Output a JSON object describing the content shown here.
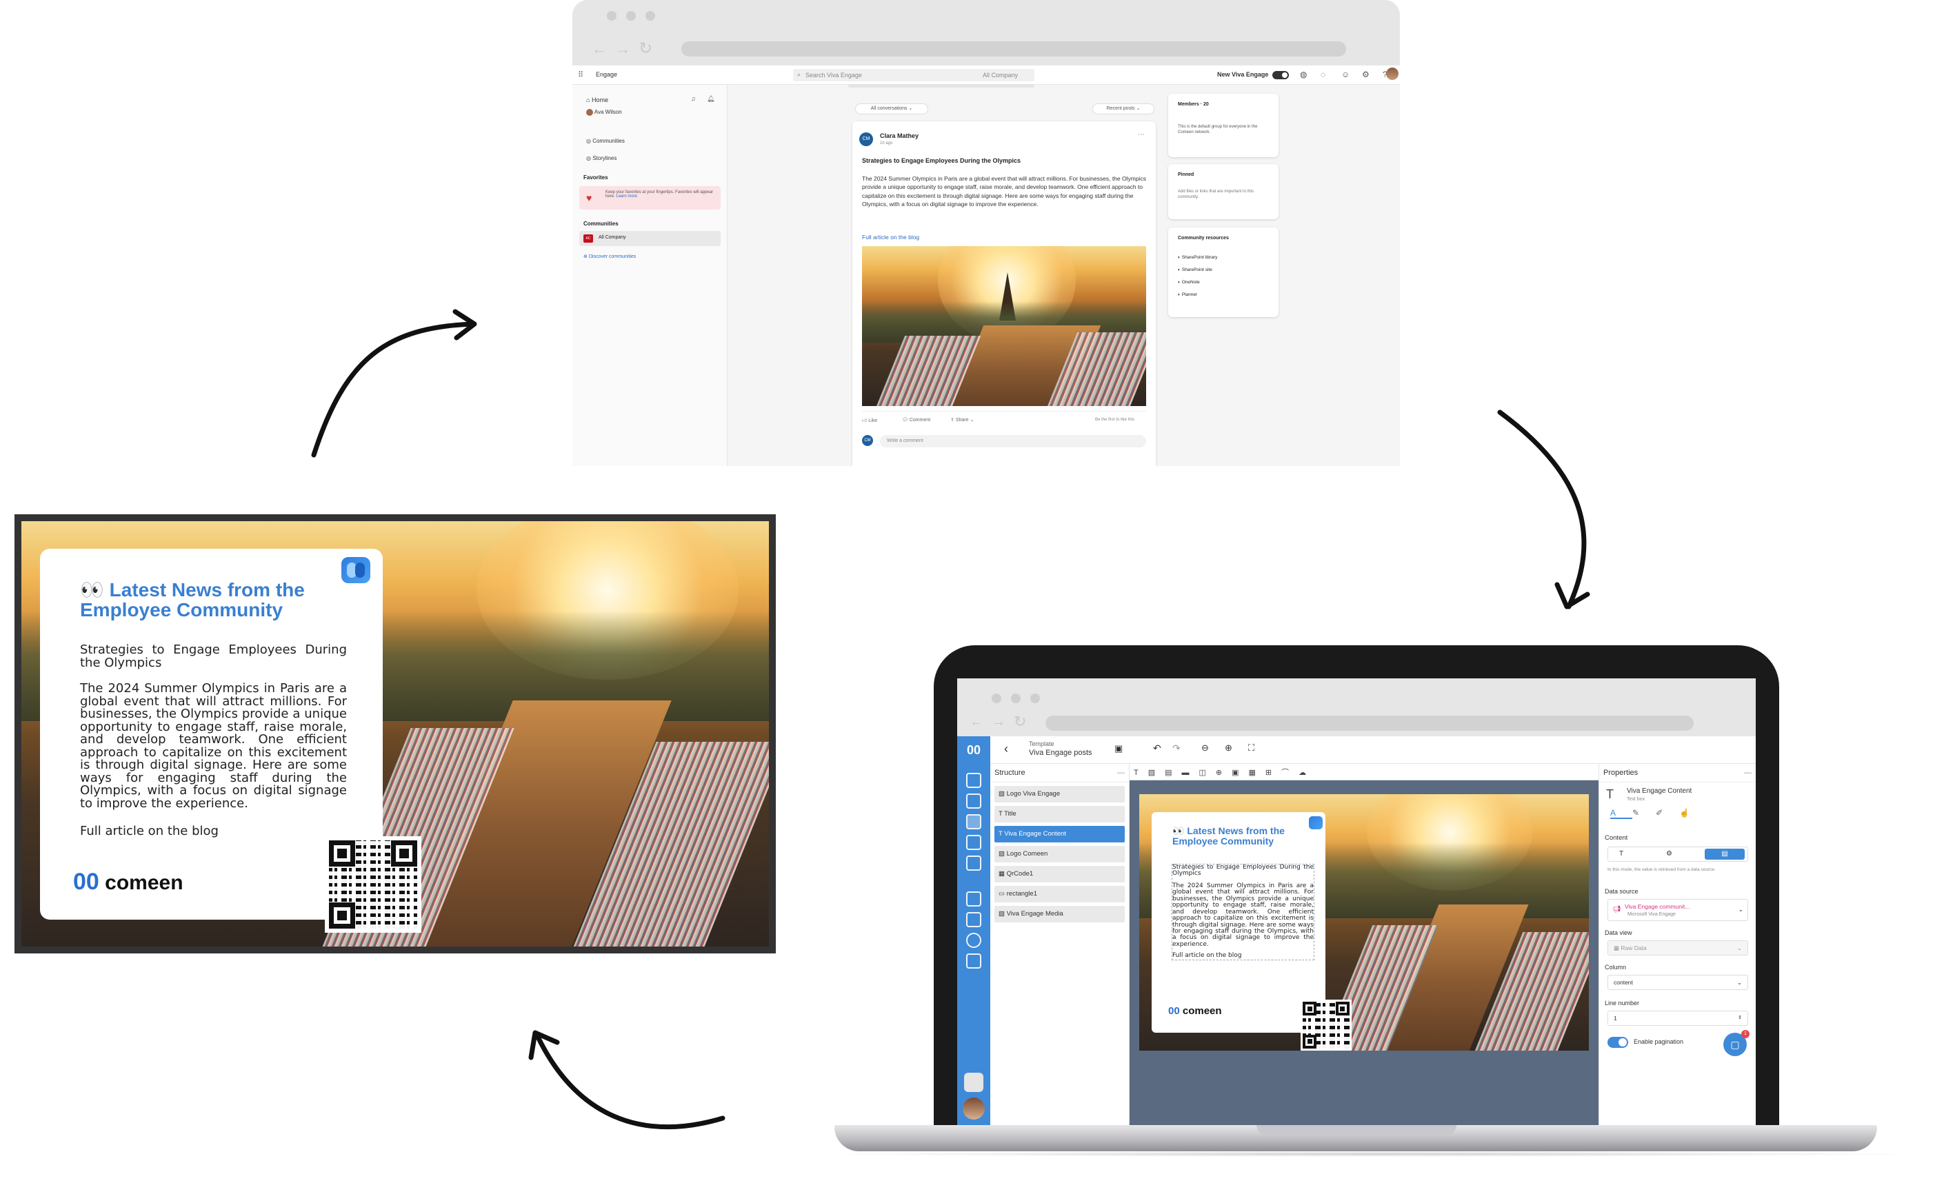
{
  "viva_browser": {
    "app_name": "Engage",
    "search_placeholder": "Search Viva Engage",
    "search_scope": "All Company",
    "toggle_label": "New Viva Engage",
    "nav": {
      "home": "Home",
      "user": "Ava Wilson",
      "communities": "Communities",
      "storylines": "Storylines"
    },
    "favorites_header": "Favorites",
    "favorites_tip": "Keep your favorites at your fingertips. Favorites will appear here.",
    "favorites_tip_link": "Learn more",
    "communities_header": "Communities",
    "community_badge": "AC",
    "community_item": "All Company",
    "discover": "Discover communities",
    "filter_left": "All conversations",
    "filter_right": "Recent posts",
    "post": {
      "author_initials": "CM",
      "author": "Clara Mathey",
      "time": "1h ago",
      "title": "Strategies to Engage Employees During the Olympics",
      "body": "The 2024 Summer Olympics in Paris are a global event that will attract millions. For businesses, the Olympics provide a unique opportunity to engage staff, raise morale, and develop teamwork. One efficient approach to capitalize on this excitement is through digital signage. Here are some ways for engaging staff during the Olympics, with a focus on digital signage to improve the experience.",
      "link": "Full article on the blog",
      "like": "Like",
      "comment": "Comment",
      "share": "Share",
      "first_like": "Be the first to like this",
      "comment_placeholder": "Write a comment"
    },
    "members": {
      "title": "Members · 20",
      "desc": "This is the default group for everyone in the Comeen network."
    },
    "pinned": {
      "title": "Pinned",
      "desc": "Add files or links that are important to this community."
    },
    "resources": {
      "title": "Community resources",
      "items": [
        "SharePoint library",
        "SharePoint site",
        "OneNote",
        "Planner"
      ]
    }
  },
  "signage": {
    "emoji": "👀",
    "title": "Latest News from the Employee Community",
    "subtitle": "Strategies to Engage Employees During the Olympics",
    "body": "The 2024 Summer Olympics in Paris are a global event that will attract millions. For businesses, the Olympics provide a unique opportunity to engage staff, raise morale, and develop teamwork. One efficient approach to capitalize on this excitement is through digital signage. Here are some ways for engaging staff during the Olympics, with a focus on digital signage to improve the experience.",
    "link": "Full article on the blog",
    "brand_mark": "00",
    "brand": "comeen"
  },
  "editor": {
    "template_label": "Template",
    "template_name": "Viva Engage posts",
    "structure_title": "Structure",
    "layers": [
      "Logo Viva Engage",
      "Title",
      "Viva Engage Content",
      "Logo Comeen",
      "QrCode1",
      "rectangle1",
      "Viva Engage Media"
    ],
    "selected_layer": "Viva Engage Content",
    "properties_title": "Properties",
    "element_name": "Viva Engage Content",
    "element_type": "Text box",
    "content_label": "Content",
    "content_hint": "In this mode, the value is retrieved from a data source.",
    "data_source_label": "Data source",
    "data_source_value": "Viva Engage communit...",
    "data_source_sub": "Microsoft Viva Engage",
    "data_view_label": "Data view",
    "data_view_value": "Raw Data",
    "column_label": "Column",
    "column_value": "content",
    "line_number_label": "Line number",
    "line_number_value": "1",
    "pagination_label": "Enable pagination",
    "chat_badge": "1"
  },
  "colors": {
    "accent": "#3a84d6",
    "title_blue": "#3a7fd0",
    "sidebar_blue": "#3e8ad8",
    "selected_layer": "#3e8ad8",
    "viva_link": "#2b6cc4"
  }
}
